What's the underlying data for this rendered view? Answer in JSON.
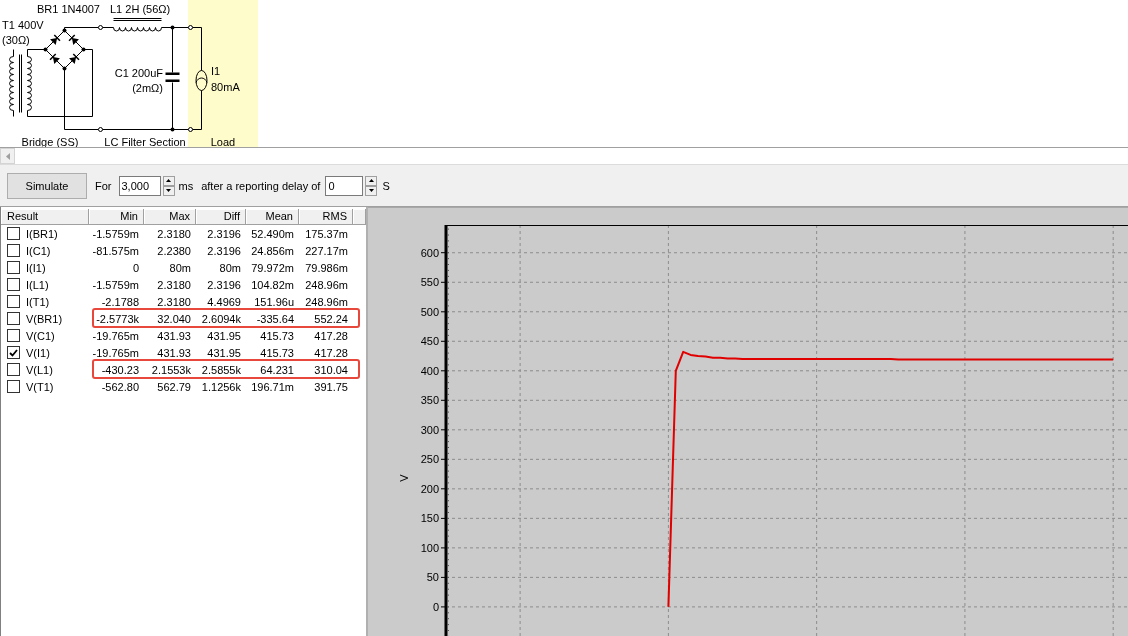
{
  "schematic": {
    "components": [
      {
        "kind": "transformer",
        "label": "T1 400V",
        "detail": "(30Ω)"
      },
      {
        "kind": "bridge",
        "label": "BR1 1N4007"
      },
      {
        "kind": "inductor",
        "label": "L1 2H (56Ω)"
      },
      {
        "kind": "capacitor",
        "label": "C1 200uF",
        "detail": "(2mΩ)"
      },
      {
        "kind": "current_source",
        "label": "I1",
        "detail": "80mA"
      }
    ],
    "sections": [
      {
        "label": "Bridge (SS)",
        "highlighted": false
      },
      {
        "label": "LC Filter Section",
        "highlighted": false
      },
      {
        "label": "Load",
        "highlighted": true
      }
    ]
  },
  "toolbar": {
    "simulate": "Simulate",
    "for_label": "For",
    "duration": {
      "value": "3,000"
    },
    "duration_unit": "ms",
    "delay_label": "after a reporting delay of",
    "delay": {
      "value": "0"
    },
    "delay_unit": "S"
  },
  "results": {
    "columns": [
      "Result",
      "Min",
      "Max",
      "Diff",
      "Mean",
      "RMS"
    ],
    "rows": [
      {
        "name": "I(BR1)",
        "checked": false,
        "highlighted": false,
        "values": [
          "-1.5759m",
          "2.3180",
          "2.3196",
          "52.490m",
          "175.37m"
        ]
      },
      {
        "name": "I(C1)",
        "checked": false,
        "highlighted": false,
        "values": [
          "-81.575m",
          "2.2380",
          "2.3196",
          "24.856m",
          "227.17m"
        ]
      },
      {
        "name": "I(I1)",
        "checked": false,
        "highlighted": false,
        "values": [
          "0",
          "80m",
          "80m",
          "79.972m",
          "79.986m"
        ]
      },
      {
        "name": "I(L1)",
        "checked": false,
        "highlighted": false,
        "values": [
          "-1.5759m",
          "2.3180",
          "2.3196",
          "104.82m",
          "248.96m"
        ]
      },
      {
        "name": "I(T1)",
        "checked": false,
        "highlighted": false,
        "values": [
          "-2.1788",
          "2.3180",
          "4.4969",
          "151.96u",
          "248.96m"
        ]
      },
      {
        "name": "V(BR1)",
        "checked": false,
        "highlighted": true,
        "values": [
          "-2.5773k",
          "32.040",
          "2.6094k",
          "-335.64",
          "552.24"
        ]
      },
      {
        "name": "V(C1)",
        "checked": false,
        "highlighted": false,
        "values": [
          "-19.765m",
          "431.93",
          "431.95",
          "415.73",
          "417.28"
        ]
      },
      {
        "name": "V(I1)",
        "checked": true,
        "highlighted": false,
        "values": [
          "-19.765m",
          "431.93",
          "431.95",
          "415.73",
          "417.28"
        ]
      },
      {
        "name": "V(L1)",
        "checked": false,
        "highlighted": true,
        "values": [
          "-430.23",
          "2.1553k",
          "2.5855k",
          "64.231",
          "310.04"
        ]
      },
      {
        "name": "V(T1)",
        "checked": false,
        "highlighted": false,
        "values": [
          "-562.80",
          "562.79",
          "1.1256k",
          "196.71m",
          "391.75"
        ]
      }
    ]
  },
  "chart": {
    "chart_data": {
      "type": "line",
      "ylabel": "V",
      "grid": true,
      "ylim": [
        -51,
        647
      ],
      "yticks": [
        0,
        50,
        100,
        150,
        200,
        250,
        300,
        350,
        400,
        450,
        500,
        550,
        600
      ],
      "categories": [
        null,
        null,
        null,
        null,
        null,
        null,
        null,
        null,
        null,
        null,
        null,
        null,
        null,
        null,
        null,
        null,
        null,
        null,
        null,
        null,
        null,
        null,
        null,
        null,
        null,
        null,
        null,
        null,
        null,
        null,
        null,
        null,
        null,
        null,
        null,
        null,
        null,
        null,
        null,
        null,
        null,
        null,
        null,
        null,
        null,
        null,
        null,
        null,
        null,
        null,
        null,
        null,
        null,
        null,
        null,
        null,
        null,
        null,
        null,
        null,
        null,
        null,
        null,
        null,
        null,
        null,
        null,
        null,
        null,
        null,
        null,
        null,
        null,
        null,
        null,
        null,
        null,
        null,
        null,
        null,
        null,
        null,
        null,
        null,
        null,
        null,
        null,
        null,
        null,
        null,
        null,
        null,
        null
      ],
      "series": [
        {
          "color": "#e00000",
          "values": [
            null,
            null,
            null,
            null,
            null,
            null,
            null,
            null,
            null,
            null,
            null,
            null,
            null,
            null,
            null,
            null,
            null,
            null,
            null,
            null,
            null,
            null,
            null,
            null,
            null,
            null,
            null,
            null,
            null,
            null,
            0,
            400,
            432,
            427,
            425,
            424,
            422,
            422,
            421,
            421,
            420,
            420,
            420,
            420,
            420,
            420,
            420,
            420,
            420,
            420,
            420,
            420,
            420,
            420,
            420,
            420,
            420,
            420,
            420,
            420,
            420,
            419,
            419,
            419,
            419,
            419,
            419,
            419,
            419,
            419,
            419,
            419,
            419,
            419,
            419,
            419,
            419,
            419,
            419,
            419,
            419,
            419,
            419,
            419,
            419,
            419,
            419,
            419,
            419,
            419,
            419,
            null,
            null
          ]
        }
      ]
    }
  }
}
